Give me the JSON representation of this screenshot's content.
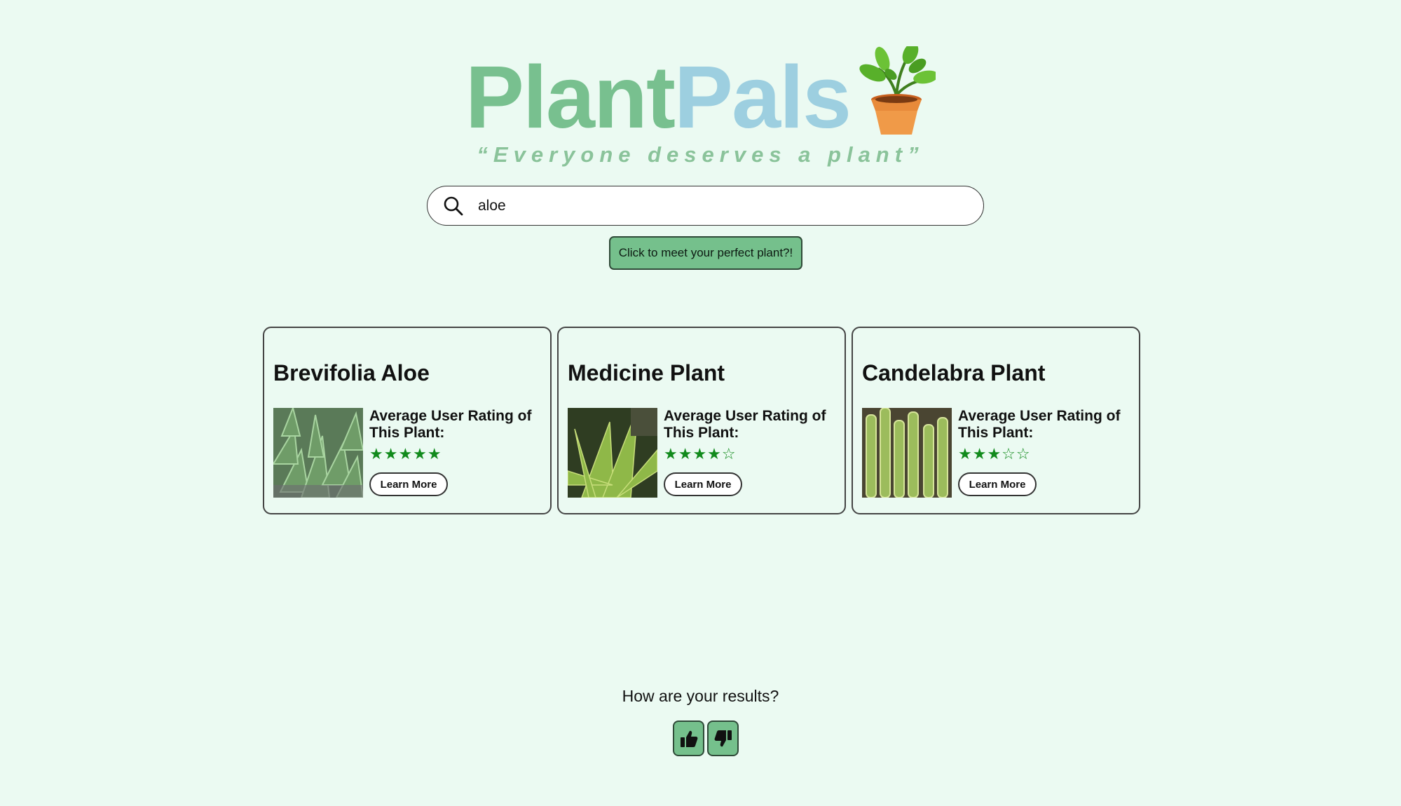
{
  "app": {
    "logo_part1": "Plant",
    "logo_part2": "Pals",
    "logo_icon": "potted-plant-icon",
    "tagline": "“Everyone deserves a plant”"
  },
  "search": {
    "value": "aloe",
    "icon": "search-icon"
  },
  "cta_label": "Click to meet your perfect plant?!",
  "cards": [
    {
      "title": "Brevifolia Aloe",
      "rating_label": "Average User Rating of This Plant:",
      "rating": 5,
      "stars": "★★★★★",
      "button": "Learn More"
    },
    {
      "title": "Medicine Plant",
      "rating_label": "Average User Rating of This Plant:",
      "rating": 4,
      "stars": "★★★★☆",
      "button": "Learn More"
    },
    {
      "title": "Candelabra Plant",
      "rating_label": "Average User Rating of This Plant:",
      "rating": 3,
      "stars": "★★★☆☆",
      "button": "Learn More"
    }
  ],
  "feedback": {
    "question": "How are your results?",
    "thumbs_up_icon": "thumbs-up-icon",
    "thumbs_down_icon": "thumbs-down-icon"
  },
  "colors": {
    "background": "#ebfaf2",
    "brand_green": "#78c08f",
    "brand_blue": "#9dcfe0",
    "button_green": "#75c08c",
    "star_green": "#118a1c"
  }
}
